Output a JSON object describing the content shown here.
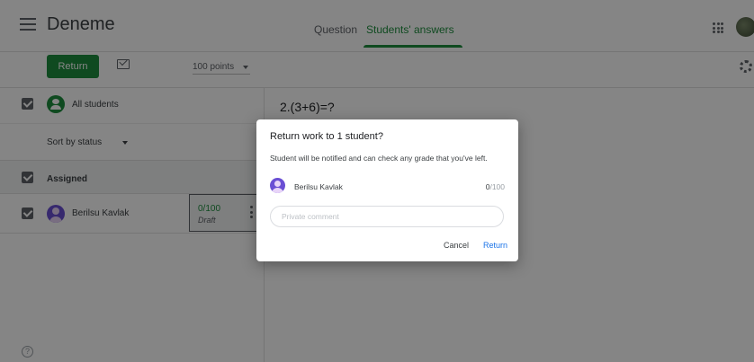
{
  "app": {
    "title": "Deneme"
  },
  "tabs": [
    {
      "label": "Question"
    },
    {
      "label": "Students' answers"
    }
  ],
  "toolbar": {
    "return_label": "Return",
    "points_value": "100 points"
  },
  "left_panel": {
    "all_students_label": "All students",
    "sort_label": "Sort by status",
    "assigned_label": "Assigned",
    "students": [
      {
        "name": "Berilsu Kavlak",
        "grade": "0/100",
        "status": "Draft"
      }
    ],
    "help_glyph": "?"
  },
  "question": {
    "title": "2.(3+6)=?"
  },
  "dialog": {
    "title": "Return work to 1 student?",
    "body": "Student will be notified and can check any grade that you've left.",
    "student_name": "Berilsu Kavlak",
    "grade_score": "0",
    "grade_total": "/100",
    "comment_placeholder": "Private comment",
    "cancel_label": "Cancel",
    "return_label": "Return"
  },
  "colors": {
    "accent_green": "#1e8e3e",
    "link_blue": "#1a73e8",
    "avatar_purple": "#6a4fd4"
  },
  "icons": [
    "menu-icon",
    "mail-icon",
    "apps-icon",
    "settings-icon",
    "group-icon",
    "help-icon",
    "more-icon"
  ]
}
